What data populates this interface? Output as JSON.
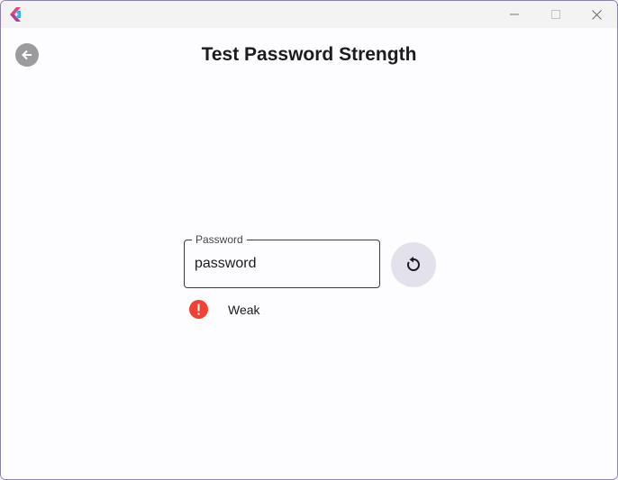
{
  "window": {
    "icons": {
      "logo": "app-logo-icon",
      "minimize": "minimize-icon",
      "maximize": "maximize-icon",
      "close": "close-icon"
    }
  },
  "header": {
    "title": "Test Password Strength",
    "back_icon": "arrow-left-icon"
  },
  "password_field": {
    "label": "Password",
    "value": "password"
  },
  "refresh_button": {
    "icon": "refresh-icon"
  },
  "strength": {
    "text": "Weak",
    "icon": "error-icon",
    "color": "#f04234"
  },
  "colors": {
    "background": "#fdfcff",
    "title_bar": "#f3f3f3",
    "accent_button": "#e3e2ec",
    "back_button": "#9b9b9e"
  }
}
